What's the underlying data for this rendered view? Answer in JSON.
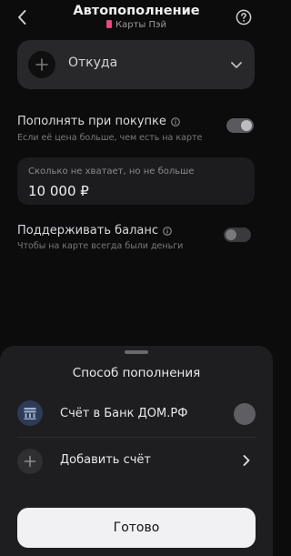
{
  "header": {
    "title": "Автопополнение",
    "subtitle": "Карты Пэй"
  },
  "source": {
    "label": "Откуда"
  },
  "topup_on_purchase": {
    "title": "Пополнять при покупке",
    "description": "Если её цена больше, чем есть на карте",
    "enabled": true
  },
  "limit": {
    "placeholder": "Сколько не хватает, но не больше",
    "value": "10 000 ₽"
  },
  "keep_balance": {
    "title": "Поддерживать баланс",
    "description": "Чтобы на карте всегда были деньги",
    "enabled": false
  },
  "sheet": {
    "title": "Способ пополнения",
    "account_label": "Счёт в Банк ДОМ.РФ",
    "add_label": "Добавить счёт",
    "done_label": "Готово"
  },
  "colors": {
    "background": "#0c0c0d",
    "sheet": "#1e1e20",
    "card_accent": "#e64a78",
    "button": "#f1f1f3"
  },
  "icons": {
    "back": "chevron-left-icon",
    "help": "question-circle-icon",
    "source_add": "plus-icon",
    "dropdown": "chevron-down-icon",
    "info": "info-icon",
    "bank": "bank-logo-icon",
    "add_account": "plus-icon",
    "go": "chevron-right-icon"
  }
}
